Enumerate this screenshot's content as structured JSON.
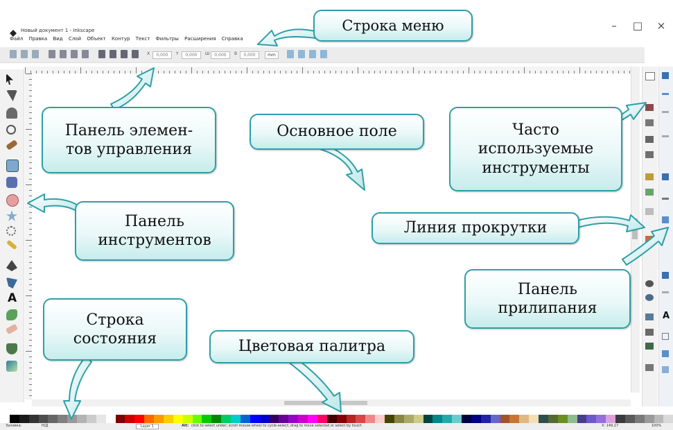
{
  "window": {
    "title": "Новый документ 1 - Inkscape",
    "minimize": "–",
    "maximize": "□",
    "close": "×"
  },
  "menu": [
    "Файл",
    "Правка",
    "Вид",
    "Слой",
    "Объект",
    "Контур",
    "Текст",
    "Фильтры",
    "Расширения",
    "Справка"
  ],
  "toolbar": {
    "x": "X",
    "x_value": "0,000",
    "y": "Y",
    "y_value": "0,000",
    "w": "Ш",
    "w_value": "0,000",
    "h": "В",
    "h_value": "0,000",
    "unit": "mm"
  },
  "callouts": {
    "menu": "Строка меню",
    "controls": "Панель элемен-\nтов управления",
    "main": "Основное поле",
    "commands": "Часто\nиспользуемые\nинструменты",
    "tools": "Панель\nинструментов",
    "scroll": "Линия прокрутки",
    "snap": "Панель\nприлипания",
    "status": "Строка\nсостояния",
    "palette": "Цветовая палитра"
  },
  "status": {
    "fill_label": "Заливка:",
    "fill_value": "Н/Д",
    "layer": "Layer 1",
    "hint_bold": "Alt:",
    "hint": "click to select under; scroll mouse-wheel to cycle-select; drag to move selected or select by touch",
    "coords": "X: 149,17",
    "zoom": "100%"
  },
  "colors": {
    "callout_border": "#2e9fa6",
    "callout_fill": "#c7ecec",
    "toolbar_button": "#8fb7d6"
  },
  "icons": [
    "selector-icon",
    "node-icon",
    "tweak-icon",
    "zoom-icon",
    "measure-icon",
    "rect-icon",
    "3dbox-icon",
    "ellipse-icon",
    "star-icon",
    "spiral-icon",
    "pencil-icon",
    "pen-icon",
    "calligraphy-icon",
    "text-icon",
    "spray-icon",
    "eraser-icon",
    "bucket-icon",
    "gradient-icon"
  ]
}
